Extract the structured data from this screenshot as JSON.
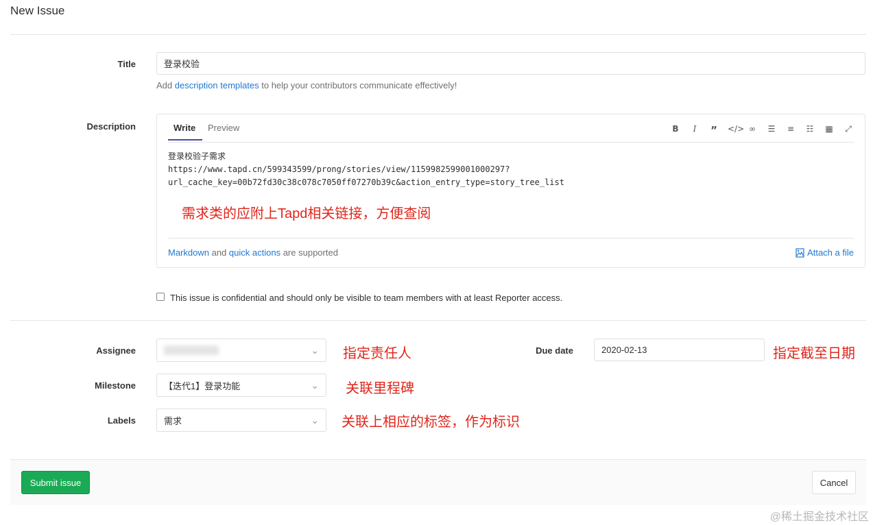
{
  "page_title": "New Issue",
  "title_field": {
    "label": "Title",
    "value": "登录校验"
  },
  "templates_hint": {
    "prefix": "Add",
    "link": "description templates",
    "suffix": "to help your contributors communicate effectively!"
  },
  "description": {
    "label": "Description",
    "tabs": [
      "Write",
      "Preview"
    ],
    "toolbar_icons": [
      "bold-icon",
      "italic-icon",
      "quote-icon",
      "code-icon",
      "link-icon",
      "bullet-list-icon",
      "numbered-list-icon",
      "task-list-icon",
      "table-icon",
      "fullscreen-icon"
    ],
    "content_lines": [
      "登录校验子需求",
      "https://www.tapd.cn/599343599/prong/stories/view/1159982599001000297?",
      "url_cache_key=00b72fd30c38c078c7050ff07270b39c&action_entry_type=story_tree_list"
    ],
    "footer_link1": "Markdown",
    "footer_and": "and",
    "footer_link2": "quick actions",
    "footer_suffix": "are supported",
    "attach_label": "Attach a file"
  },
  "annotations": {
    "description_note": "需求类的应附上Tapd相关链接，方便查阅",
    "assignee_note": "指定责任人",
    "due_date_note": "指定截至日期",
    "milestone_note": "关联里程碑",
    "labels_note": "关联上相应的标签，作为标识"
  },
  "confidential": {
    "checked": false,
    "text": "This issue is confidential and should only be visible to team members with at least Reporter access."
  },
  "assignee": {
    "label": "Assignee",
    "value": ""
  },
  "due_date": {
    "label": "Due date",
    "value": "2020-02-13"
  },
  "milestone": {
    "label": "Milestone",
    "value": "【迭代1】登录功能"
  },
  "labels": {
    "label": "Labels",
    "value": "需求"
  },
  "buttons": {
    "submit": "Submit issue",
    "cancel": "Cancel"
  },
  "watermark": "@稀土掘金技术社区",
  "colors": {
    "submit_green": "#1aaa55",
    "link_blue": "#1f78d1",
    "annotation_red": "#e0261b"
  }
}
